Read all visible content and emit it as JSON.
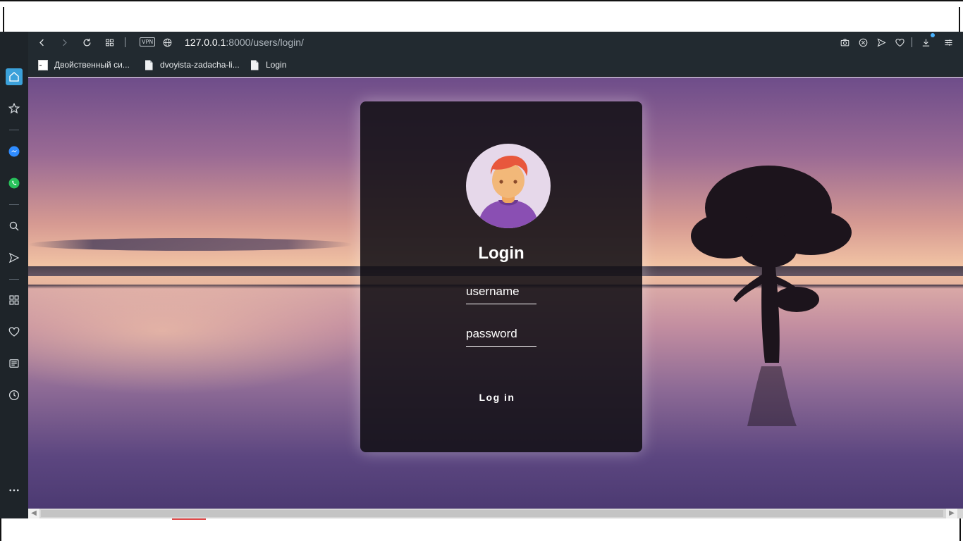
{
  "browser": {
    "url_host": "127.0.0.1",
    "url_rest": ":8000/users/login/",
    "vpn_label": "VPN",
    "accent_color": "#4ab3ff"
  },
  "bookmarks": [
    {
      "label": "Двойственный си...",
      "icon": "bookmark-page-icon"
    },
    {
      "label": "dvoyista-zadacha-li...",
      "icon": "document-icon"
    },
    {
      "label": "Login",
      "icon": "document-icon"
    }
  ],
  "sidebar": {
    "items": [
      "home-icon",
      "bookmarks-icon",
      "messenger-icon",
      "whatsapp-icon",
      "search-icon",
      "send-icon",
      "speed-dial-icon",
      "heart-icon",
      "news-icon",
      "history-icon",
      "more-icon"
    ]
  },
  "login": {
    "title": "Login",
    "username_placeholder": "username",
    "password_placeholder": "password",
    "submit_label": "Log in"
  }
}
